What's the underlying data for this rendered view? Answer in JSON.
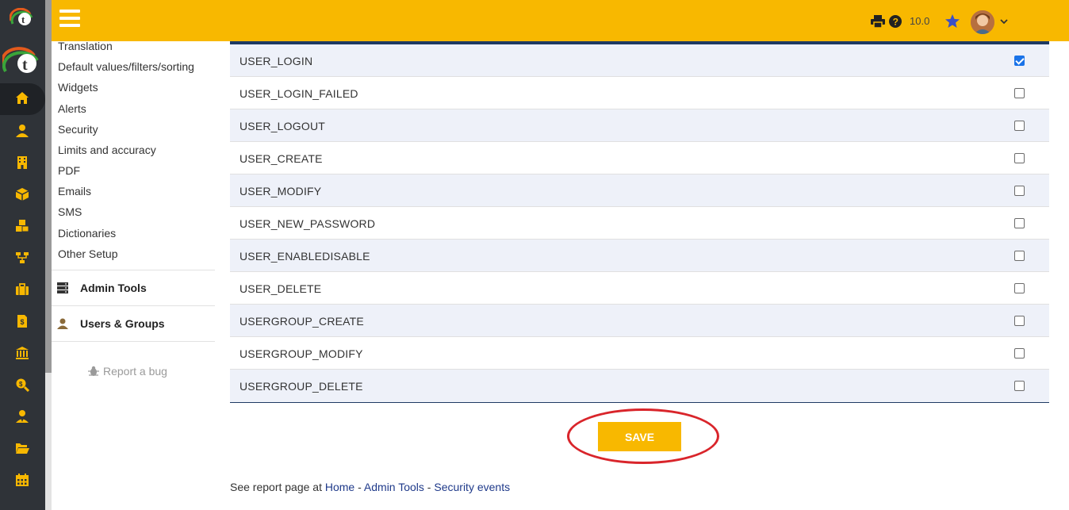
{
  "topbar": {
    "version": "10.0"
  },
  "menu": {
    "items": [
      "Translation",
      "Default values/filters/sorting",
      "Widgets",
      "Alerts",
      "Security",
      "Limits and accuracy",
      "PDF",
      "Emails",
      "SMS",
      "Dictionaries",
      "Other Setup"
    ],
    "sections": [
      {
        "label": "Admin Tools",
        "icon": "server-icon"
      },
      {
        "label": "Users & Groups",
        "icon": "user-icon"
      }
    ],
    "report_bug": "Report a bug"
  },
  "rail": {
    "icons": [
      "home-icon",
      "user-icon",
      "building-icon",
      "cube-icon",
      "cubes-icon",
      "sitemap-icon",
      "briefcase-icon",
      "invoice-icon",
      "bank-icon",
      "search-dollar-icon",
      "user-tie-icon",
      "folder-open-icon",
      "calendar-icon"
    ]
  },
  "events": [
    {
      "name": "USER_LOGIN",
      "checked": true
    },
    {
      "name": "USER_LOGIN_FAILED",
      "checked": false
    },
    {
      "name": "USER_LOGOUT",
      "checked": false
    },
    {
      "name": "USER_CREATE",
      "checked": false
    },
    {
      "name": "USER_MODIFY",
      "checked": false
    },
    {
      "name": "USER_NEW_PASSWORD",
      "checked": false
    },
    {
      "name": "USER_ENABLEDISABLE",
      "checked": false
    },
    {
      "name": "USER_DELETE",
      "checked": false
    },
    {
      "name": "USERGROUP_CREATE",
      "checked": false
    },
    {
      "name": "USERGROUP_MODIFY",
      "checked": false
    },
    {
      "name": "USERGROUP_DELETE",
      "checked": false
    }
  ],
  "save_label": "SAVE",
  "footer": {
    "prefix": "See report page at ",
    "links": [
      "Home",
      "Admin Tools",
      "Security events"
    ],
    "separator": " - "
  },
  "colors": {
    "accent": "#f8b800",
    "rail": "#2f3338",
    "table_border": "#1f3a63",
    "checkbox_checked": "#1a73e8",
    "highlight_ring": "#d9252b"
  }
}
